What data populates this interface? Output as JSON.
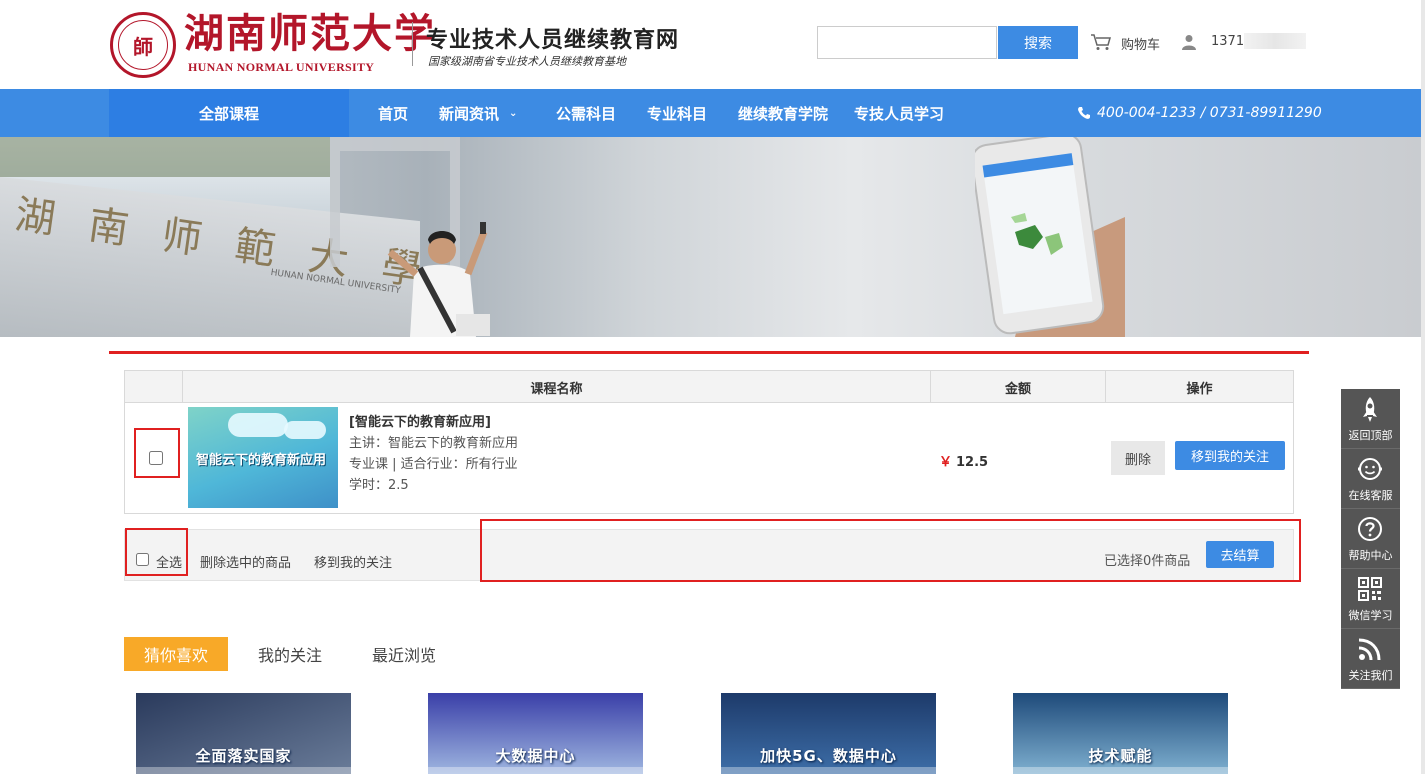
{
  "header": {
    "logo_cn": "湖南师范大学",
    "logo_en": "HUNAN NORMAL UNIVERSITY",
    "logo_seal_text": "師",
    "site_title": "专业技术人员继续教育网",
    "site_subtitle": "国家级湖南省专业技术人员继续教育基地",
    "search_placeholder": "",
    "search_label": "搜索",
    "cart_label": "购物车",
    "user_label": "1371"
  },
  "nav": {
    "all_courses": "全部课程",
    "items": [
      "首页",
      "新闻资讯",
      "公需科目",
      "专业科目",
      "继续教育学院",
      "专技人员学习"
    ],
    "caret": "⌄",
    "phone": "400-004-1233 / 0731-89911290"
  },
  "banner": {
    "wall_text": "湖南师範大學",
    "wall_en": "HUNAN NORMAL UNIVERSITY"
  },
  "cart": {
    "headers": [
      "",
      "课程名称",
      "金额",
      "操作"
    ],
    "item": {
      "thumb_label": "智能云下的教育新应用",
      "name": "[智能云下的教育新应用]",
      "lecturer": "主讲：智能云下的教育新应用",
      "category": "专业课  |  适合行业：所有行业",
      "hours": "学时：2.5",
      "currency": "￥",
      "price": "12.5",
      "delete_label": "删除",
      "fav_label": "移到我的关注"
    },
    "footer": {
      "select_all": "全选",
      "delete_selected": "删除选中的商品",
      "move_selected": "移到我的关注",
      "selected_info": "已选择0件商品",
      "checkout": "去结算"
    }
  },
  "tabs": [
    "猜你喜欢",
    "我的关注",
    "最近浏览"
  ],
  "recommend": [
    {
      "title": "全面落实国家",
      "color1": "#2a3a5c",
      "color2": "#6a7c99"
    },
    {
      "title": "大数据中心",
      "color1": "#3a3fa8",
      "color2": "#9fb6e0"
    },
    {
      "title": "加快5G、数据中心",
      "color1": "#1d3a6a",
      "color2": "#3d6ea8"
    },
    {
      "title": "技术赋能",
      "color1": "#1e4a7a",
      "color2": "#7fb0d0"
    }
  ],
  "sidebar": [
    "返回顶部",
    "在线客服",
    "帮助中心",
    "微信学习",
    "关注我们"
  ],
  "colors": {
    "brand_blue": "#3d8be3",
    "brand_red": "#b3162a",
    "highlight_red": "#e02020",
    "tab_orange": "#f8a928"
  }
}
